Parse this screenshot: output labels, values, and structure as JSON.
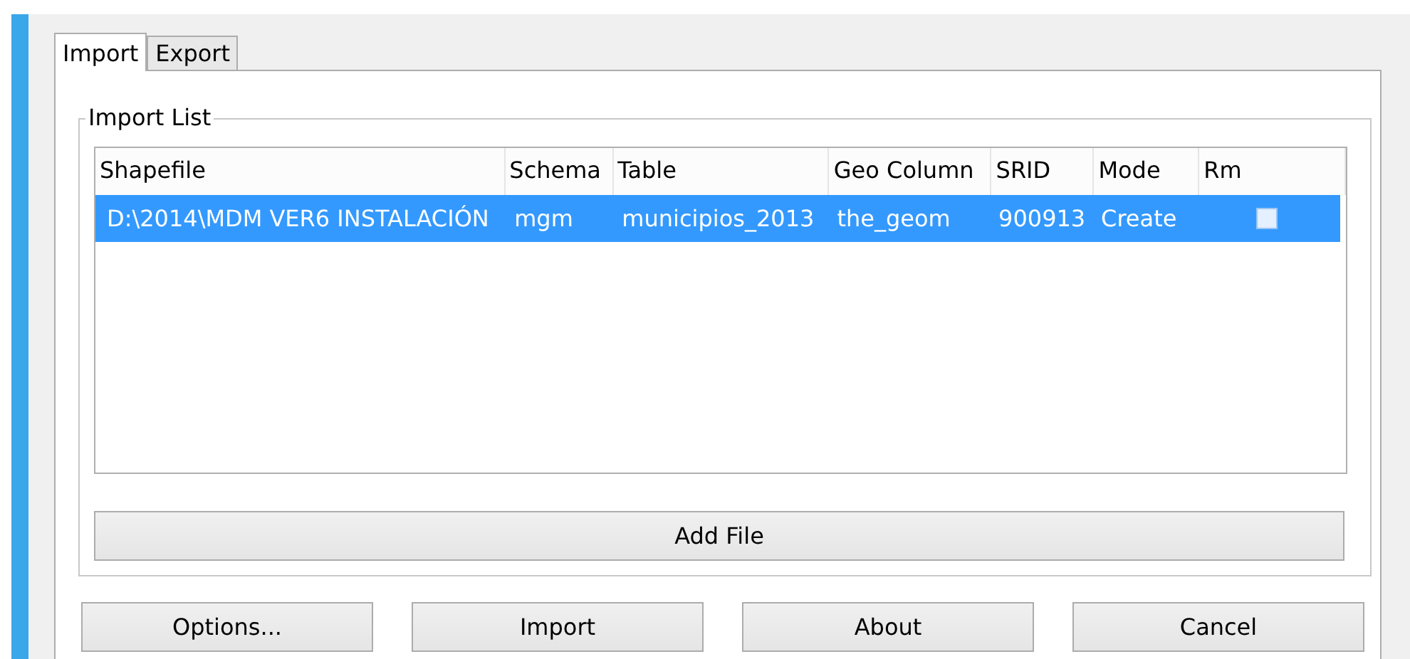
{
  "tabs": [
    {
      "label": "Import",
      "selected": true
    },
    {
      "label": "Export",
      "selected": false
    }
  ],
  "import_list": {
    "title": "Import List",
    "columns": [
      "Shapefile",
      "Schema",
      "Table",
      "Geo Column",
      "SRID",
      "Mode",
      "Rm"
    ],
    "rows": [
      {
        "shapefile": "D:\\2014\\MDM VER6 INSTALACIÓN",
        "schema": "mgm",
        "table": "municipios_2013",
        "geo_column": "the_geom",
        "srid": "900913",
        "mode": "Create",
        "rm": false,
        "selected": true
      }
    ],
    "add_button": "Add File"
  },
  "buttons": [
    "Options...",
    "Import",
    "About",
    "Cancel"
  ]
}
